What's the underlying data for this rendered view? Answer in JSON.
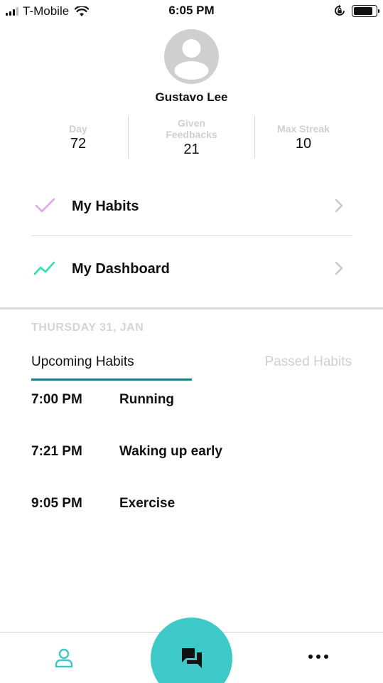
{
  "status_bar": {
    "carrier": "T-Mobile",
    "time": "6:05 PM"
  },
  "profile": {
    "name": "Gustavo Lee",
    "stats": [
      {
        "label": "Day",
        "value": "72"
      },
      {
        "label": "Given Feedbacks",
        "value": "21"
      },
      {
        "label": "Max Streak",
        "value": "10"
      }
    ]
  },
  "menu": {
    "habits_label": "My Habits",
    "dashboard_label": "My Dashboard",
    "habits_icon": "check-icon",
    "dashboard_icon": "trend-line-icon"
  },
  "schedule": {
    "date": "THURSDAY 31, JAN",
    "tabs": {
      "upcoming": "Upcoming Habits",
      "passed": "Passed Habits"
    },
    "items": [
      {
        "time": "7:00 PM",
        "name": "Running"
      },
      {
        "time": "7:21 PM",
        "name": "Waking up early"
      },
      {
        "time": "9:05 PM",
        "name": "Exercise"
      }
    ]
  },
  "bottom_nav": {
    "profile_icon": "person-icon",
    "chat_icon": "chat-icon",
    "more_icon": "more-icon"
  },
  "colors": {
    "accent_teal": "#3ec9c9",
    "tab_underline": "#1b7f84",
    "check_purple": "#e2a4f1",
    "trend_green": "#2fe0b0",
    "muted_text": "#cfcfcf"
  }
}
